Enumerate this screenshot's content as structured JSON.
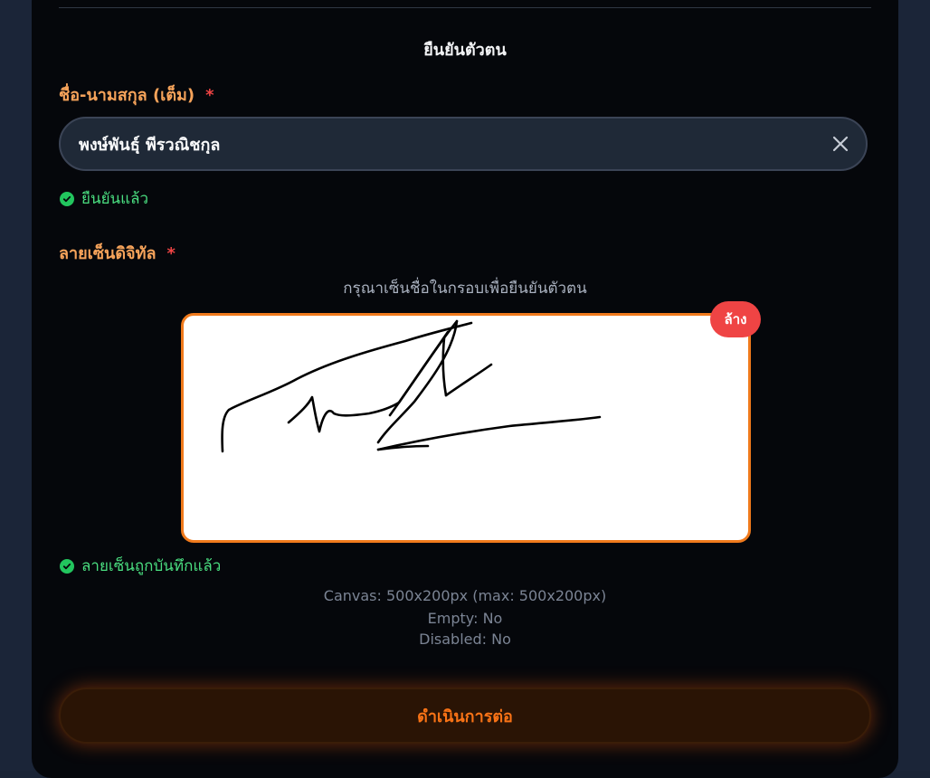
{
  "form": {
    "section_title": "ยืนยันตัวตน",
    "name_label": "ชื่อ-นามสกุล (เต็ม)",
    "required_mark": "*",
    "name_value": "พงษ์พันธุ์ พีรวณิชกุล",
    "name_status": "ยืนยันแล้ว",
    "signature_label": "ลายเซ็นดิจิทัล",
    "signature_hint": "กรุณาเซ็นชื่อในกรอบเพื่อยืนยันตัวตน",
    "clear_label": "ล้าง",
    "signature_status": "ลายเซ็นถูกบันทึกแล้ว",
    "debug_canvas": "Canvas: 500x200px (max: 500x200px)",
    "debug_empty": "Empty: No",
    "debug_disabled": "Disabled: No",
    "continue_label": "ดำเนินการต่อ"
  },
  "colors": {
    "accent": "#f97316",
    "label": "#f6a35a",
    "required": "#ef4444",
    "success": "#4ade80",
    "panel": "#05070b"
  },
  "icons": {
    "clear_input": "close-icon",
    "status": "check-circle-icon"
  }
}
